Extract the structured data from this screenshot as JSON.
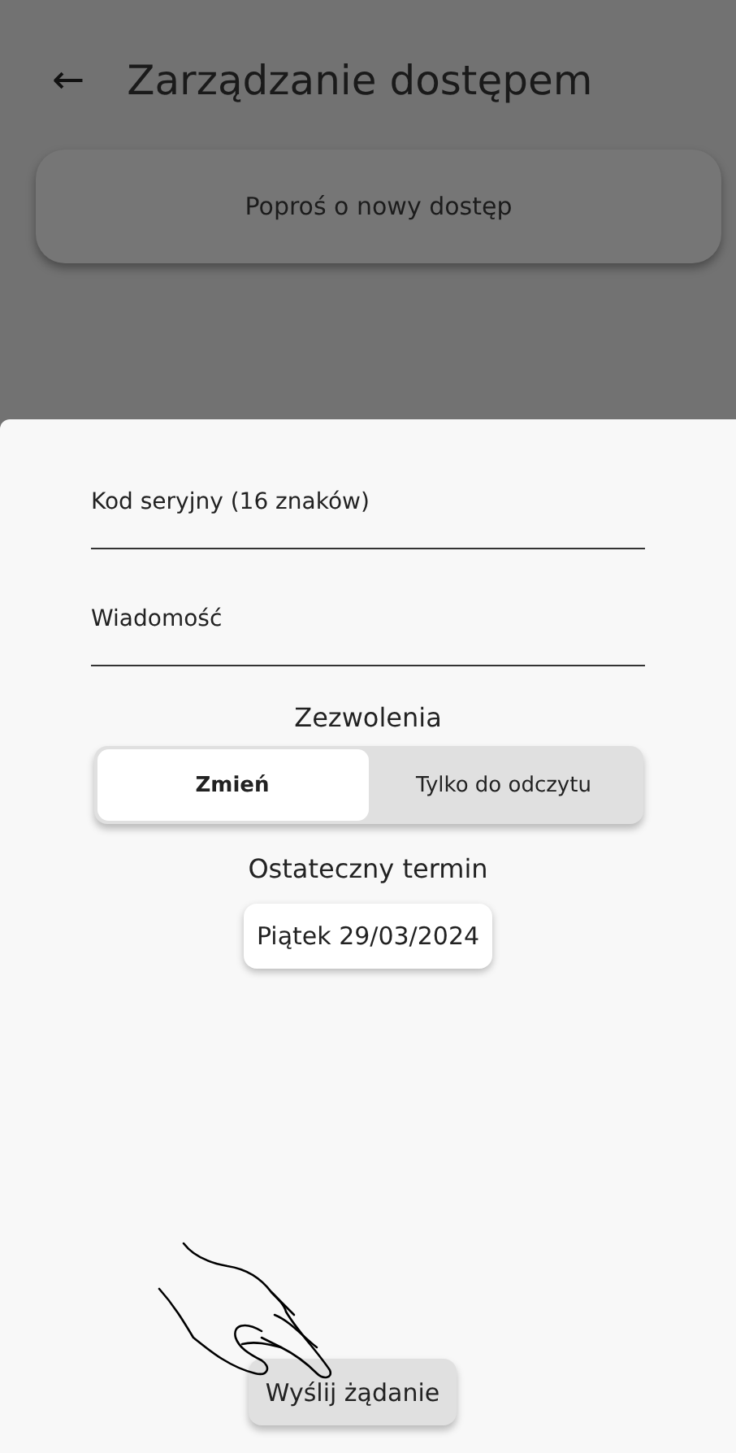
{
  "header": {
    "back_icon": "←",
    "title": "Zarządzanie dostępem"
  },
  "request_card": {
    "label": "Poproś o nowy dostęp"
  },
  "sheet": {
    "fields": [
      {
        "placeholder": "Kod seryjny (16 znaków)"
      },
      {
        "placeholder": "Wiadomość"
      }
    ],
    "permissions": {
      "title": "Zezwolenia",
      "options": [
        {
          "label": "Zmień",
          "selected": true
        },
        {
          "label": "Tylko do odczytu",
          "selected": false
        }
      ]
    },
    "deadline": {
      "title": "Ostateczny termin",
      "date": "Piątek 29/03/2024"
    },
    "submit": {
      "label": "Wyślij żądanie"
    }
  }
}
